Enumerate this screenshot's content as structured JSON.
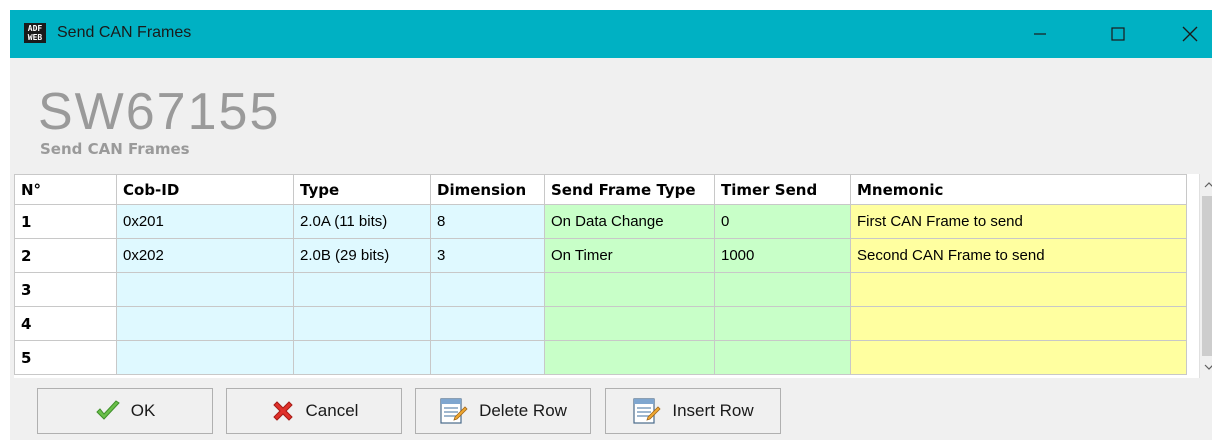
{
  "window": {
    "title": "Send CAN Frames",
    "icon_text_top": "ADF",
    "icon_text_bottom": "WEB"
  },
  "header": {
    "title": "SW67155",
    "subtitle": "Send CAN Frames"
  },
  "table": {
    "columns": [
      "N°",
      "Cob-ID",
      "Type",
      "Dimension",
      "Send Frame Type",
      "Timer Send",
      "Mnemonic"
    ],
    "rows": [
      {
        "n": "1",
        "cob_id": "0x201",
        "type": "2.0A (11 bits)",
        "dimension": "8",
        "send_frame_type": "On Data Change",
        "timer_send": "0",
        "mnemonic": "First CAN Frame to send"
      },
      {
        "n": "2",
        "cob_id": "0x202",
        "type": "2.0B (29 bits)",
        "dimension": "3",
        "send_frame_type": "On Timer",
        "timer_send": "1000",
        "mnemonic": "Second CAN Frame to send"
      },
      {
        "n": "3",
        "cob_id": "",
        "type": "",
        "dimension": "",
        "send_frame_type": "",
        "timer_send": "",
        "mnemonic": ""
      },
      {
        "n": "4",
        "cob_id": "",
        "type": "",
        "dimension": "",
        "send_frame_type": "",
        "timer_send": "",
        "mnemonic": ""
      },
      {
        "n": "5",
        "cob_id": "",
        "type": "",
        "dimension": "",
        "send_frame_type": "",
        "timer_send": "",
        "mnemonic": ""
      }
    ]
  },
  "buttons": {
    "ok": "OK",
    "cancel": "Cancel",
    "delete_row": "Delete Row",
    "insert_row": "Insert Row"
  },
  "colors": {
    "titlebar": "#00b1c3",
    "cyan_cells": "#dff9ff",
    "green_cells": "#c8ffc8",
    "yellow_cells": "#ffffa0"
  },
  "icons": {
    "ok": "checkmark-icon",
    "cancel": "red-x-icon",
    "delete_row": "delete-row-icon",
    "insert_row": "insert-row-icon",
    "minimize": "minimize-icon",
    "maximize": "maximize-icon",
    "close": "close-icon"
  }
}
